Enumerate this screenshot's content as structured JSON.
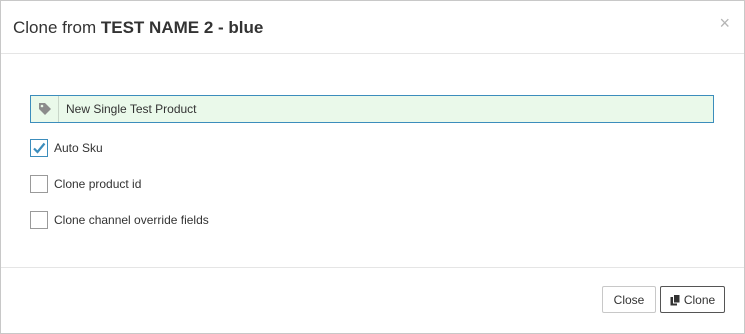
{
  "modal": {
    "title_prefix": "Clone from",
    "title_name": "TEST NAME 2 - blue",
    "close_symbol": "×"
  },
  "form": {
    "name_value": "New Single Test Product",
    "name_icon": "tag-icon",
    "checkboxes": [
      {
        "label": "Auto Sku",
        "checked": true
      },
      {
        "label": "Clone product id",
        "checked": false
      },
      {
        "label": "Clone channel override fields",
        "checked": false
      }
    ]
  },
  "footer": {
    "close_label": "Close",
    "clone_label": "Clone",
    "clone_icon": "copy-icon"
  },
  "colors": {
    "accent": "#3c8dbc",
    "input_bg": "#eaf9ea"
  }
}
